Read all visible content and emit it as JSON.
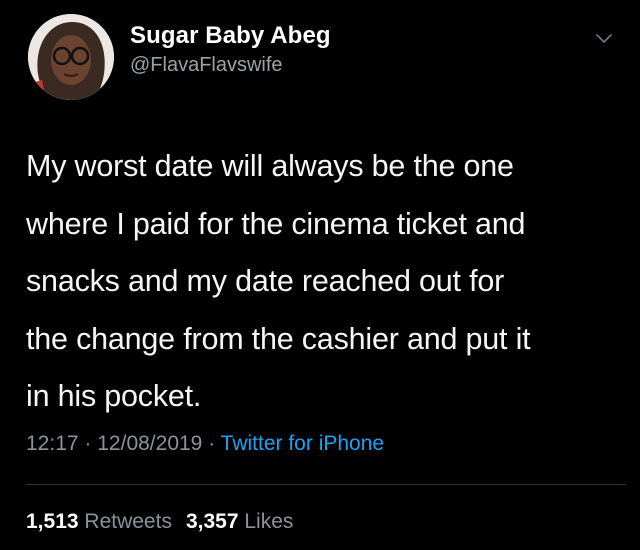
{
  "user": {
    "display_name": "Sugar Baby Abeg",
    "handle": "@FlavaFlavswife"
  },
  "tweet": {
    "lines": [
      "My worst date will always be the one",
      "where I paid for the cinema ticket and",
      "snacks and my date reached out for",
      "the change from the cashier and put it",
      "in his pocket."
    ],
    "time": "12:17",
    "separator": "·",
    "date": "12/08/2019",
    "source": "Twitter for iPhone"
  },
  "stats": {
    "retweets_count": "1,513",
    "retweets_label": "Retweets",
    "likes_count": "3,357",
    "likes_label": "Likes"
  },
  "icons": {
    "avatar": "avatar",
    "menu": "chevron-down-icon"
  },
  "colors": {
    "background": "#000000",
    "text": "#ffffff",
    "secondary": "#8a939b",
    "link": "#1da1f2"
  }
}
